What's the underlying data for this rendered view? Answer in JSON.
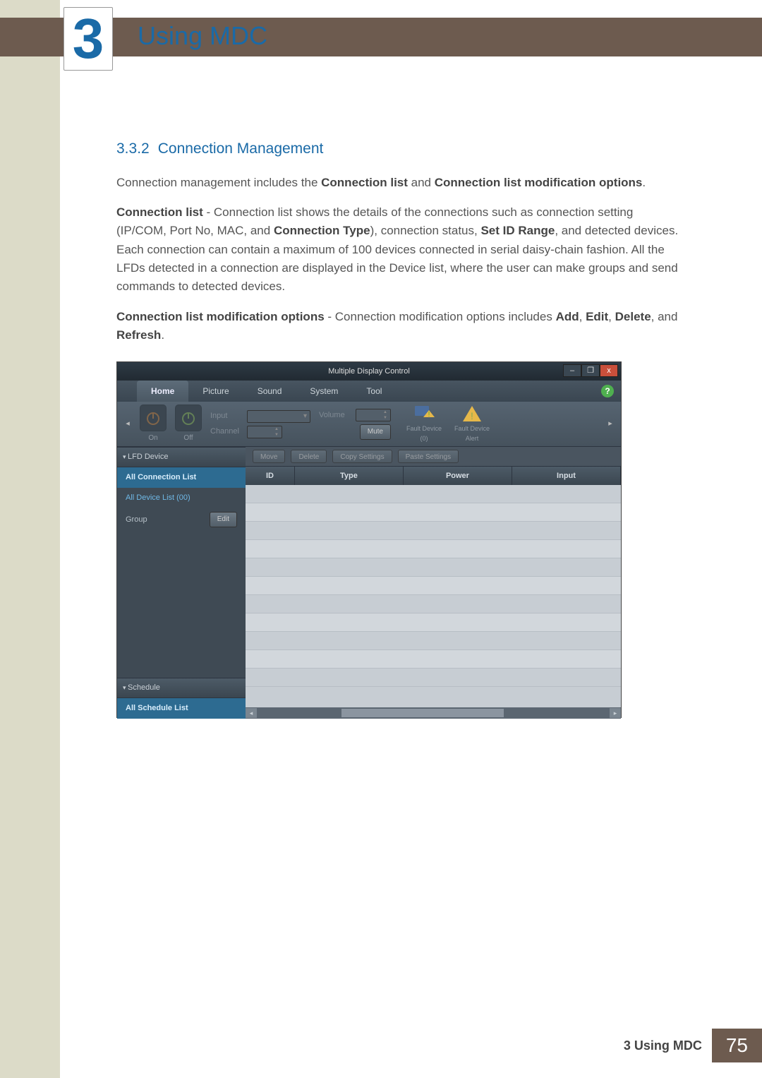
{
  "chapter": "3",
  "page_title": "Using MDC",
  "section": {
    "number": "3.3.2",
    "title": "Connection Management"
  },
  "paragraphs": {
    "p1_a": "Connection management includes the ",
    "p1_b1": "Connection list",
    "p1_c": " and ",
    "p1_b2": "Connection list modification options",
    "p1_d": ".",
    "p2_b1": "Connection list",
    "p2_a": " - Connection list shows the details of the connections such as connection setting (IP/COM, Port No, MAC, and ",
    "p2_b2": "Connection Type",
    "p2_b": "), connection status, ",
    "p2_b3": "Set ID Range",
    "p2_c": ", and detected devices. Each connection can contain a maximum of 100 devices connected in serial daisy-chain fashion. All the LFDs detected in a connection are displayed in the Device list, where the user can make groups and send commands to detected devices.",
    "p3_b1": "Connection list modification options",
    "p3_a": " - Connection modification options includes ",
    "p3_b2": "Add",
    "p3_s1": ", ",
    "p3_b3": "Edit",
    "p3_s2": ", ",
    "p3_b4": "Delete",
    "p3_s3": ", and ",
    "p3_b5": "Refresh",
    "p3_d": "."
  },
  "app": {
    "window_title": "Multiple Display Control",
    "win_min": "–",
    "win_max": "❐",
    "win_close": "x",
    "help": "?",
    "menu": [
      "Home",
      "Picture",
      "Sound",
      "System",
      "Tool"
    ],
    "menu_active_index": 0,
    "power_on": "On",
    "power_off": "Off",
    "input_label": "Input",
    "channel_label": "Channel",
    "volume_label": "Volume",
    "mute_label": "Mute",
    "fault1": "Fault Device",
    "fault1_count": "(0)",
    "fault2": "Fault Device",
    "fault2_sub": "Alert",
    "side_lfd": "LFD Device",
    "side_all_conn": "All Connection List",
    "side_all_device": "All Device List (00)",
    "side_group": "Group",
    "side_edit": "Edit",
    "side_schedule": "Schedule",
    "side_all_schedule": "All Schedule List",
    "actions": [
      "Move",
      "Delete",
      "Copy Settings",
      "Paste Settings"
    ],
    "columns": [
      "ID",
      "Type",
      "Power",
      "Input"
    ]
  },
  "footer": {
    "label": "3 Using MDC",
    "page": "75"
  }
}
